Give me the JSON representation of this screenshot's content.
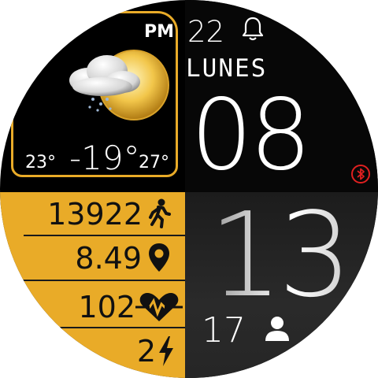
{
  "clock": {
    "ampm": "PM",
    "hour": "08",
    "minute": "13",
    "seconds": "17",
    "day_number": "22",
    "day_name": "LUNES"
  },
  "weather": {
    "current_temp": "-19°",
    "low_temp": "23°",
    "high_temp": "27°",
    "icon": "partly-cloudy-rain-icon"
  },
  "stats": {
    "steps": "13922",
    "distance": "8.49",
    "heart_rate": "102",
    "battery": "2"
  },
  "icons": {
    "alarm": "bell-icon",
    "bluetooth": "bluetooth-icon",
    "steps": "walking-icon",
    "distance": "location-pin-icon",
    "heart": "heart-rate-icon",
    "battery": "lightning-icon",
    "user": "person-icon"
  },
  "colors": {
    "accent": "#e9ab28",
    "bluetooth": "#e02020",
    "background": "#000000"
  }
}
